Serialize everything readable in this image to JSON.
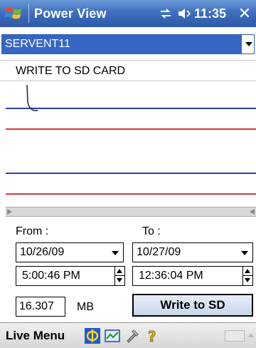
{
  "titlebar": {
    "title": "Power View",
    "time": "11:35",
    "close_label": "✕"
  },
  "device": {
    "selected": "SERVENT11"
  },
  "write_header": "WRITE TO SD CARD",
  "range": {
    "from_label": "From :",
    "to_label": "To :",
    "from_date": "10/26/09",
    "to_date": "10/27/09",
    "from_time": "5:00:46 PM",
    "to_time": "12:36:04 PM"
  },
  "size": {
    "value": "16.307",
    "unit": "MB"
  },
  "write_button": "Write to SD",
  "menubar": {
    "live_menu": "Live Menu",
    "icons": [
      "power-view-icon",
      "graph-view-icon",
      "tools-icon",
      "help-icon"
    ]
  },
  "colors": {
    "titlebar": "#3f6fbf",
    "selection": "#3666c4",
    "line_blue": "#2f3fb0",
    "line_red": "#d83a3a"
  }
}
